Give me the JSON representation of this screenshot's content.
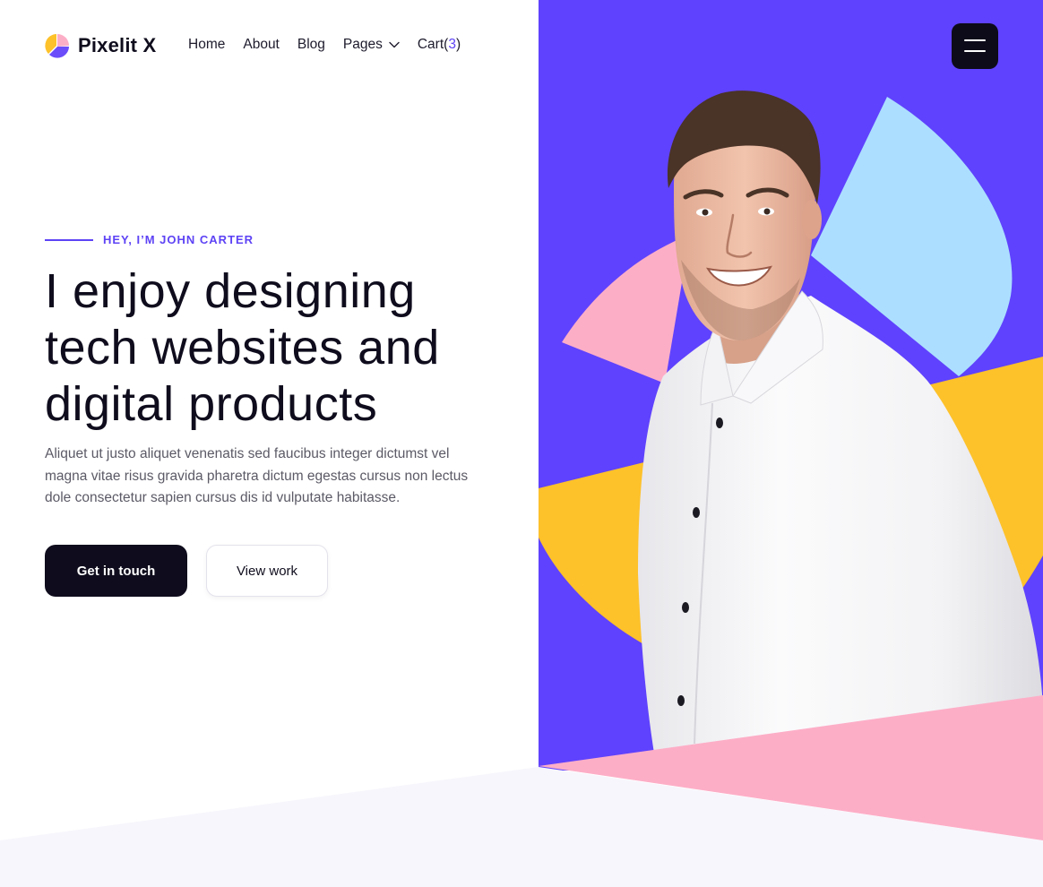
{
  "brand": {
    "name": "Pixelit X",
    "logo_icon": "pie-chart-logo-icon"
  },
  "nav": {
    "items": [
      {
        "label": "Home"
      },
      {
        "label": "About"
      },
      {
        "label": "Blog"
      },
      {
        "label": "Pages",
        "icon": "chevron-down-icon"
      }
    ],
    "cart": {
      "label": "Cart",
      "count": "3"
    },
    "menu_icon": "hamburger-menu-icon"
  },
  "hero": {
    "eyebrow": "HEY, I’M JOHN CARTER",
    "headline": [
      "I enjoy designing",
      "tech websites and",
      "digital products"
    ],
    "description": "Aliquet ut justo aliquet venenatis sed faucibus integer dictumst vel magna vitae risus gravida pharetra dictum egestas cursus non lectus dole consectetur sapien cursus dis id vulputate habitasse.",
    "primary_button": "Get in touch",
    "secondary_button": "View work"
  },
  "colors": {
    "accent": "#5d43f5",
    "dark": "#0f0d1d",
    "yellow": "#fdc12a",
    "pink": "#fdaec7",
    "light_blue": "#acdfff",
    "section_bg": "#f7f6fc"
  }
}
